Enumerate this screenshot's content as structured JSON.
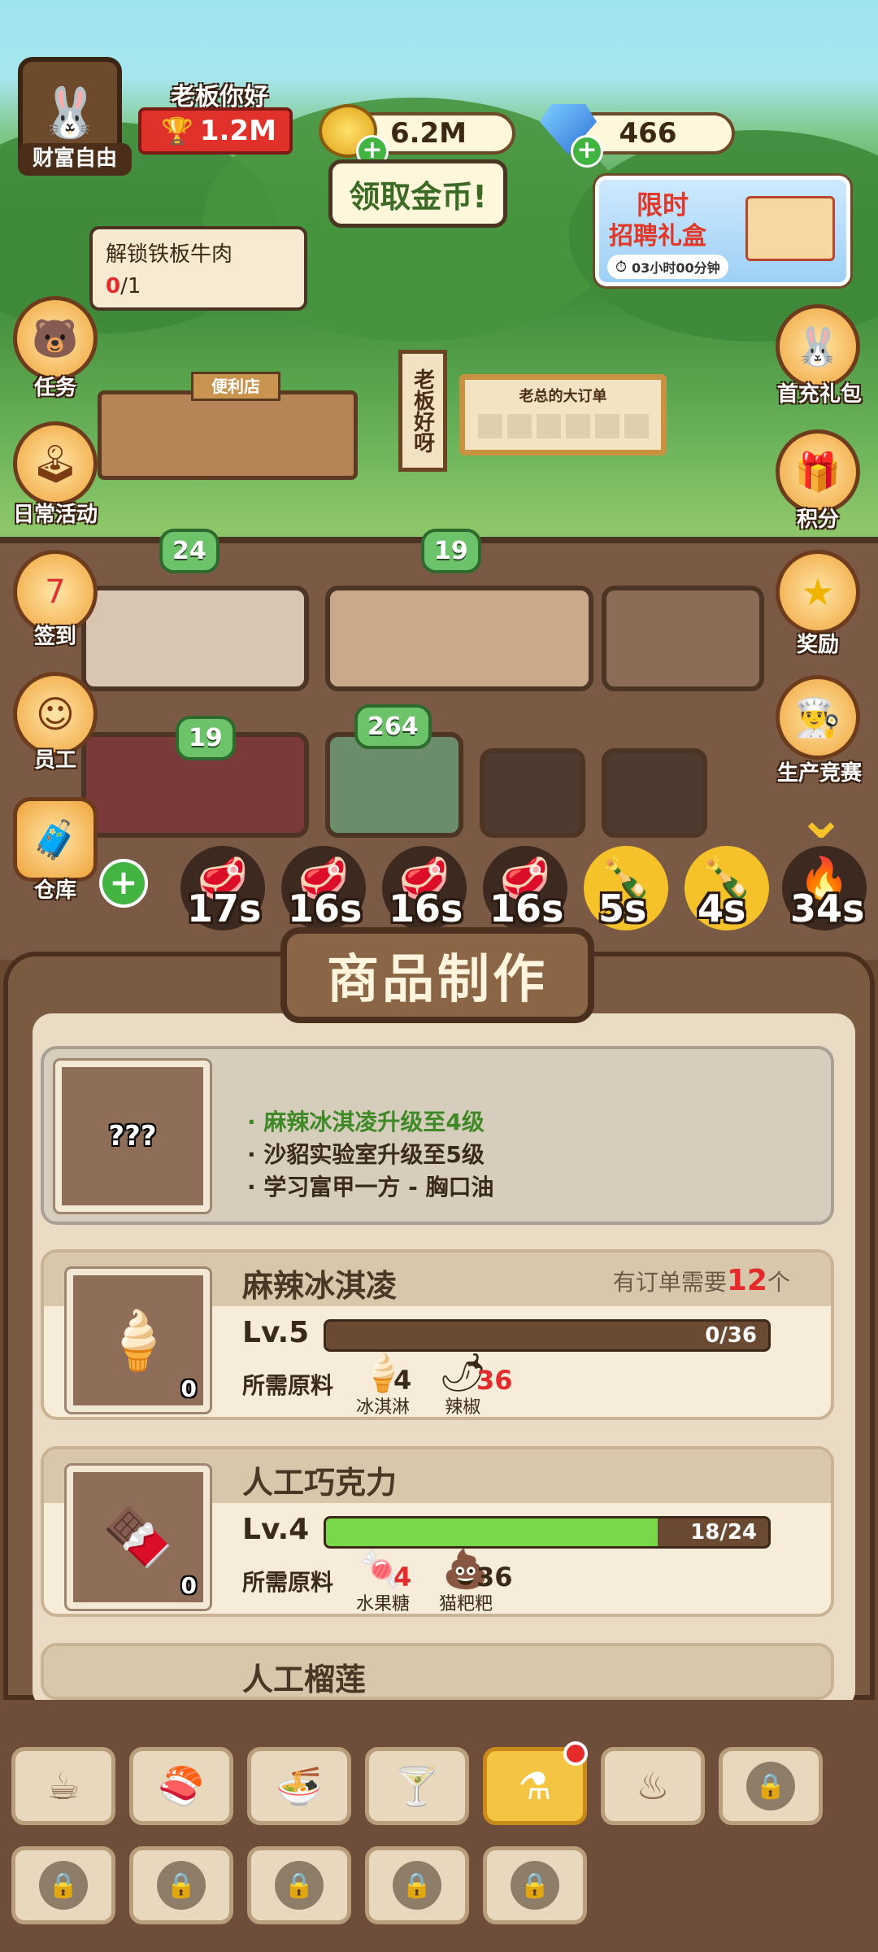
{
  "profile": {
    "title": "财富自由",
    "greeting": "老板你好",
    "trophy_value": "1.2M"
  },
  "currency": {
    "coins": "6.2M",
    "gems": "466",
    "collect_coins": "领取金币!"
  },
  "promo": {
    "title_line1": "限时",
    "title_line2": "招聘礼盒",
    "timer": "03小时00分钟"
  },
  "quest_tip": {
    "title": "解锁铁板牛肉",
    "progress_done": "0",
    "progress_total": "/1"
  },
  "left_menu": [
    {
      "label": "任务",
      "icon": "boss-icon"
    },
    {
      "label": "日常活动",
      "icon": "arcade-icon"
    },
    {
      "label": "签到",
      "icon": "calendar-icon"
    },
    {
      "label": "员工",
      "icon": "staff-icon"
    },
    {
      "label": "仓库",
      "icon": "warehouse-icon"
    }
  ],
  "right_menu": [
    {
      "label": "首充礼包",
      "icon": "first-charge-icon"
    },
    {
      "label": "积分",
      "icon": "gift-box-icon"
    },
    {
      "label": "奖励",
      "icon": "star-medal-icon"
    },
    {
      "label": "生产竞赛",
      "icon": "contest-icon"
    }
  ],
  "scene": {
    "sign_vertical": "老板好呀",
    "order_board": "老总的大订单",
    "shop_sign": "便利店",
    "bubbles": [
      "24",
      "19",
      "19",
      "264"
    ]
  },
  "queue": [
    {
      "time": "17s",
      "icon": "meat"
    },
    {
      "time": "16s",
      "icon": "meat"
    },
    {
      "time": "16s",
      "icon": "meat"
    },
    {
      "time": "16s",
      "icon": "meat"
    },
    {
      "time": "5s",
      "icon": "bottle"
    },
    {
      "time": "4s",
      "icon": "bottle"
    },
    {
      "time": "34s",
      "icon": "fire"
    }
  ],
  "panel": {
    "title": "商品制作",
    "locked_item": {
      "icon_text": "???",
      "requirements": [
        "麻辣冰淇凌升级至4级",
        "沙貂实验室升级至5级",
        "学习富甲一方 - 胸口油"
      ]
    },
    "items": [
      {
        "name": "麻辣冰淇凌",
        "order_prefix": "有订单需要",
        "order_count": "12",
        "order_suffix": "个",
        "level": "Lv.5",
        "progress_text": "0/36",
        "progress": 0.0,
        "count": "0",
        "req_label": "所需原料",
        "ingredients": [
          {
            "name": "冰淇淋",
            "amount": "4",
            "short": false
          },
          {
            "name": "辣椒",
            "amount": "36",
            "short": true
          }
        ]
      },
      {
        "name": "人工巧克力",
        "level": "Lv.4",
        "progress_text": "18/24",
        "progress": 0.75,
        "count": "0",
        "req_label": "所需原料",
        "ingredients": [
          {
            "name": "水果糖",
            "amount": "4",
            "short": true
          },
          {
            "name": "猫粑粑",
            "amount": "36",
            "short": false
          }
        ]
      },
      {
        "name": "人工榴莲"
      }
    ]
  },
  "tabs": [
    {
      "icon": "coffee-icon",
      "locked": false
    },
    {
      "icon": "sushi-icon",
      "locked": false
    },
    {
      "icon": "noodle-bowl-icon",
      "locked": false
    },
    {
      "icon": "cocktail-icon",
      "locked": false
    },
    {
      "icon": "lab-flask-icon",
      "locked": false,
      "active": true,
      "badge": true
    },
    {
      "icon": "bbq-grill-icon",
      "locked": false
    },
    {
      "icon": "lock-icon",
      "locked": true
    },
    {
      "icon": "lock-icon",
      "locked": true
    },
    {
      "icon": "lock-icon",
      "locked": true
    },
    {
      "icon": "lock-icon",
      "locked": true
    },
    {
      "icon": "lock-icon",
      "locked": true
    },
    {
      "icon": "lock-icon",
      "locked": true
    }
  ],
  "colors": {
    "accent_green": "#77d94a",
    "alert_red": "#e32b2b",
    "panel_brown": "#7b5a42"
  }
}
